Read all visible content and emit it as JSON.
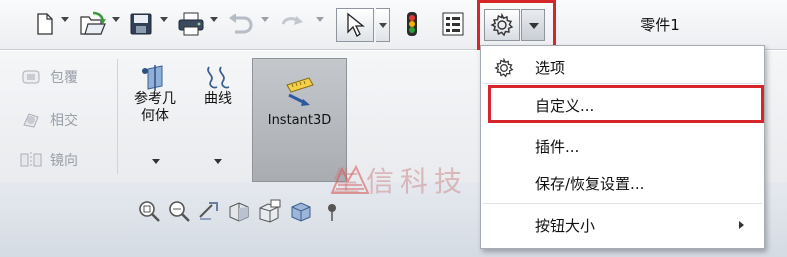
{
  "window": {
    "document_title": "零件1"
  },
  "toolbar": {
    "items": [
      {
        "name": "new-document",
        "icon": "new-document-icon"
      },
      {
        "name": "open",
        "icon": "open-folder-icon"
      },
      {
        "name": "save",
        "icon": "save-icon"
      },
      {
        "name": "print",
        "icon": "printer-icon"
      },
      {
        "name": "undo",
        "icon": "undo-icon"
      },
      {
        "name": "select",
        "icon": "cursor-icon"
      },
      {
        "name": "rebuild",
        "icon": "traffic-light-icon"
      },
      {
        "name": "file-properties",
        "icon": "properties-list-icon"
      },
      {
        "name": "options",
        "icon": "gear-icon"
      }
    ]
  },
  "ribbon": {
    "features": [
      {
        "label": "包覆",
        "icon": "wrap-icon"
      },
      {
        "label": "相交",
        "icon": "intersect-icon"
      },
      {
        "label": "镜向",
        "icon": "mirror-icon"
      }
    ],
    "buttons": [
      {
        "label_line1": "参考几",
        "label_line2": "何体",
        "icon": "reference-geometry-icon"
      },
      {
        "label_line1": "曲线",
        "label_line2": "",
        "icon": "curves-icon"
      }
    ],
    "instant3d": {
      "label": "Instant3D",
      "icon": "instant3d-ruler-icon",
      "active": true
    }
  },
  "heads_up_toolbar": {
    "icons": [
      "zoom-to-fit-icon",
      "zoom-to-area-icon",
      "previous-view-icon",
      "section-view-icon",
      "view-orientation-icon",
      "display-style-icon",
      "hide-show-icon"
    ]
  },
  "watermark": {
    "text": "生信科技"
  },
  "options_menu": {
    "items": [
      {
        "label": "选项",
        "icon": "gear-icon",
        "has_submenu": false
      },
      {
        "label": "自定义...",
        "icon": "",
        "has_submenu": false
      },
      {
        "label": "插件...",
        "icon": "",
        "has_submenu": false
      },
      {
        "label": "保存/恢复设置...",
        "icon": "",
        "has_submenu": false
      },
      {
        "label": "按钮大小",
        "icon": "",
        "has_submenu": true
      }
    ],
    "highlighted_item": "自定义..."
  },
  "colors": {
    "highlight_red": "#d6262b",
    "toolbar_bg": "#eceef1",
    "instant3d_active": "#b5b9be",
    "graphics_bg": "#dbe0e7"
  }
}
